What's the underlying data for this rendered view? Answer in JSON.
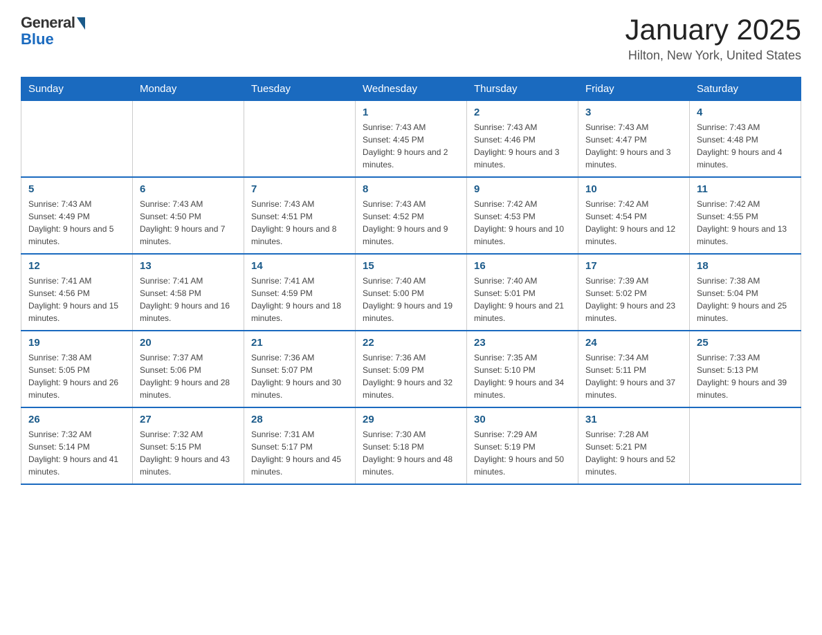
{
  "logo": {
    "general": "General",
    "blue": "Blue"
  },
  "header": {
    "title": "January 2025",
    "location": "Hilton, New York, United States"
  },
  "days_of_week": [
    "Sunday",
    "Monday",
    "Tuesday",
    "Wednesday",
    "Thursday",
    "Friday",
    "Saturday"
  ],
  "weeks": [
    [
      {
        "day": "",
        "info": ""
      },
      {
        "day": "",
        "info": ""
      },
      {
        "day": "",
        "info": ""
      },
      {
        "day": "1",
        "info": "Sunrise: 7:43 AM\nSunset: 4:45 PM\nDaylight: 9 hours and 2 minutes."
      },
      {
        "day": "2",
        "info": "Sunrise: 7:43 AM\nSunset: 4:46 PM\nDaylight: 9 hours and 3 minutes."
      },
      {
        "day": "3",
        "info": "Sunrise: 7:43 AM\nSunset: 4:47 PM\nDaylight: 9 hours and 3 minutes."
      },
      {
        "day": "4",
        "info": "Sunrise: 7:43 AM\nSunset: 4:48 PM\nDaylight: 9 hours and 4 minutes."
      }
    ],
    [
      {
        "day": "5",
        "info": "Sunrise: 7:43 AM\nSunset: 4:49 PM\nDaylight: 9 hours and 5 minutes."
      },
      {
        "day": "6",
        "info": "Sunrise: 7:43 AM\nSunset: 4:50 PM\nDaylight: 9 hours and 7 minutes."
      },
      {
        "day": "7",
        "info": "Sunrise: 7:43 AM\nSunset: 4:51 PM\nDaylight: 9 hours and 8 minutes."
      },
      {
        "day": "8",
        "info": "Sunrise: 7:43 AM\nSunset: 4:52 PM\nDaylight: 9 hours and 9 minutes."
      },
      {
        "day": "9",
        "info": "Sunrise: 7:42 AM\nSunset: 4:53 PM\nDaylight: 9 hours and 10 minutes."
      },
      {
        "day": "10",
        "info": "Sunrise: 7:42 AM\nSunset: 4:54 PM\nDaylight: 9 hours and 12 minutes."
      },
      {
        "day": "11",
        "info": "Sunrise: 7:42 AM\nSunset: 4:55 PM\nDaylight: 9 hours and 13 minutes."
      }
    ],
    [
      {
        "day": "12",
        "info": "Sunrise: 7:41 AM\nSunset: 4:56 PM\nDaylight: 9 hours and 15 minutes."
      },
      {
        "day": "13",
        "info": "Sunrise: 7:41 AM\nSunset: 4:58 PM\nDaylight: 9 hours and 16 minutes."
      },
      {
        "day": "14",
        "info": "Sunrise: 7:41 AM\nSunset: 4:59 PM\nDaylight: 9 hours and 18 minutes."
      },
      {
        "day": "15",
        "info": "Sunrise: 7:40 AM\nSunset: 5:00 PM\nDaylight: 9 hours and 19 minutes."
      },
      {
        "day": "16",
        "info": "Sunrise: 7:40 AM\nSunset: 5:01 PM\nDaylight: 9 hours and 21 minutes."
      },
      {
        "day": "17",
        "info": "Sunrise: 7:39 AM\nSunset: 5:02 PM\nDaylight: 9 hours and 23 minutes."
      },
      {
        "day": "18",
        "info": "Sunrise: 7:38 AM\nSunset: 5:04 PM\nDaylight: 9 hours and 25 minutes."
      }
    ],
    [
      {
        "day": "19",
        "info": "Sunrise: 7:38 AM\nSunset: 5:05 PM\nDaylight: 9 hours and 26 minutes."
      },
      {
        "day": "20",
        "info": "Sunrise: 7:37 AM\nSunset: 5:06 PM\nDaylight: 9 hours and 28 minutes."
      },
      {
        "day": "21",
        "info": "Sunrise: 7:36 AM\nSunset: 5:07 PM\nDaylight: 9 hours and 30 minutes."
      },
      {
        "day": "22",
        "info": "Sunrise: 7:36 AM\nSunset: 5:09 PM\nDaylight: 9 hours and 32 minutes."
      },
      {
        "day": "23",
        "info": "Sunrise: 7:35 AM\nSunset: 5:10 PM\nDaylight: 9 hours and 34 minutes."
      },
      {
        "day": "24",
        "info": "Sunrise: 7:34 AM\nSunset: 5:11 PM\nDaylight: 9 hours and 37 minutes."
      },
      {
        "day": "25",
        "info": "Sunrise: 7:33 AM\nSunset: 5:13 PM\nDaylight: 9 hours and 39 minutes."
      }
    ],
    [
      {
        "day": "26",
        "info": "Sunrise: 7:32 AM\nSunset: 5:14 PM\nDaylight: 9 hours and 41 minutes."
      },
      {
        "day": "27",
        "info": "Sunrise: 7:32 AM\nSunset: 5:15 PM\nDaylight: 9 hours and 43 minutes."
      },
      {
        "day": "28",
        "info": "Sunrise: 7:31 AM\nSunset: 5:17 PM\nDaylight: 9 hours and 45 minutes."
      },
      {
        "day": "29",
        "info": "Sunrise: 7:30 AM\nSunset: 5:18 PM\nDaylight: 9 hours and 48 minutes."
      },
      {
        "day": "30",
        "info": "Sunrise: 7:29 AM\nSunset: 5:19 PM\nDaylight: 9 hours and 50 minutes."
      },
      {
        "day": "31",
        "info": "Sunrise: 7:28 AM\nSunset: 5:21 PM\nDaylight: 9 hours and 52 minutes."
      },
      {
        "day": "",
        "info": ""
      }
    ]
  ]
}
